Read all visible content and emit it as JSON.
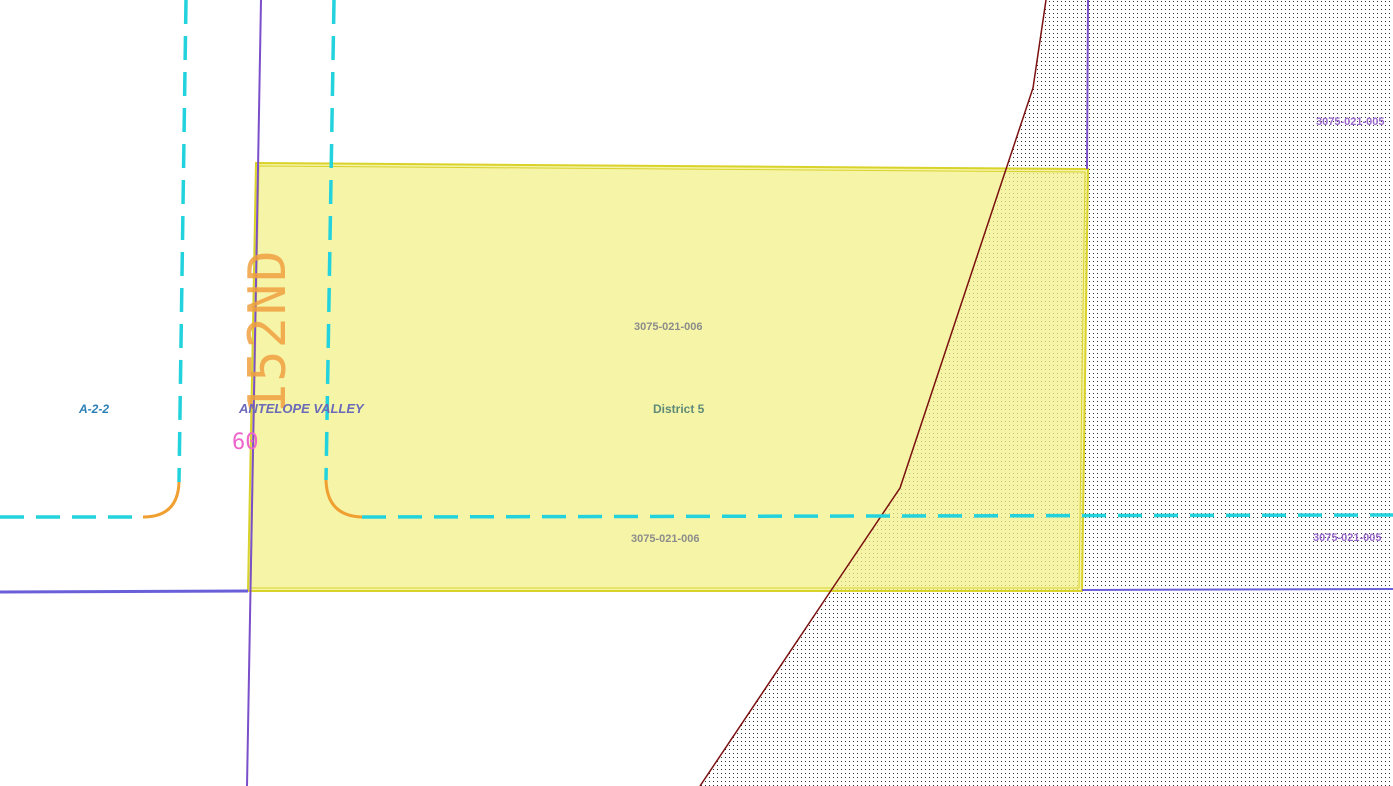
{
  "map": {
    "parcels": {
      "main_top": "3075-021-006",
      "main_bottom": "3075-021-006",
      "east_top": "3075-021-005",
      "east_bottom": "3075-021-005"
    },
    "zoning_label": "A-2-2",
    "area_label": "ANTELOPE VALLEY",
    "district_label": "District 5",
    "street_name": "152ND",
    "speed_label": "60",
    "colors": {
      "parcel_highlight_fill": "#f2f08a",
      "parcel_highlight_stroke": "#d9d22a",
      "parcel_line": "#7a4fc9",
      "road_dashed": "#22d3dd",
      "road_curve": "#f0a030",
      "boundary": "#7a1010",
      "hatch_dots": "#333333"
    }
  }
}
